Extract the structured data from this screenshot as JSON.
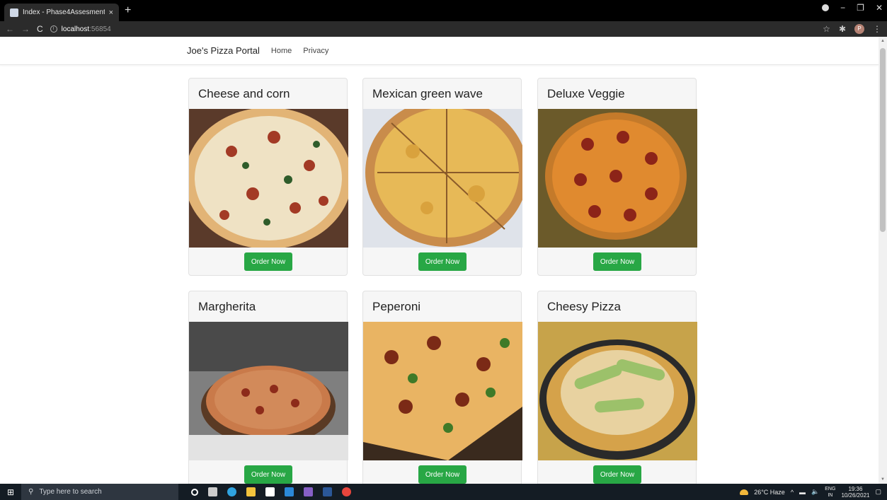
{
  "browser": {
    "tab_title": "Index - Phase4Assesment",
    "tab_close": "×",
    "new_tab": "+",
    "url_host": "localhost",
    "url_port": ":56854",
    "minimize": "−",
    "restore": "❐",
    "close": "✕",
    "profile_initial": "P"
  },
  "navbar": {
    "brand": "Joe's Pizza Portal",
    "links": [
      "Home",
      "Privacy"
    ]
  },
  "cards": [
    {
      "title": "Cheese and corn",
      "button": "Order Now"
    },
    {
      "title": "Mexican green wave",
      "button": "Order Now"
    },
    {
      "title": "Deluxe Veggie",
      "button": "Order Now"
    },
    {
      "title": "Margherita",
      "button": "Order Now"
    },
    {
      "title": "Peperoni",
      "button": "Order Now"
    },
    {
      "title": "Cheesy Pizza",
      "button": "Order Now"
    }
  ],
  "taskbar": {
    "search_placeholder": "Type here to search",
    "weather": "26°C Haze",
    "lang_top": "ENG",
    "lang_bottom": "IN",
    "time": "19:36",
    "date": "10/26/2021"
  },
  "colors": {
    "button_green": "#28a745",
    "card_bg": "#f6f6f6"
  }
}
